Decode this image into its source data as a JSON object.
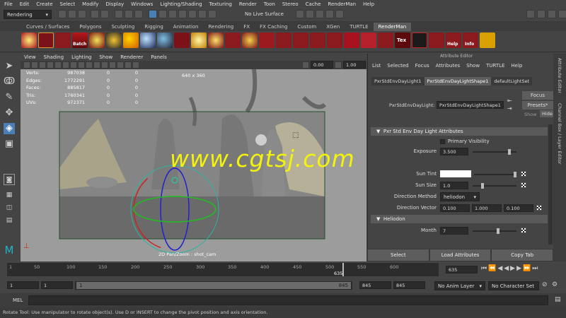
{
  "menubar": [
    "File",
    "Edit",
    "Create",
    "Select",
    "Modify",
    "Display",
    "Windows",
    "Lighting/Shading",
    "Texturing",
    "Render",
    "Toon",
    "Stereo",
    "Cache",
    "RenderMan",
    "Help"
  ],
  "statusline": {
    "menu_set": "Rendering",
    "live_surface": "No Live Surface"
  },
  "shelf_tabs": [
    "Curves / Surfaces",
    "Polygons",
    "Sculpting",
    "Rigging",
    "Animation",
    "Rendering",
    "FX",
    "FX Caching",
    "Custom",
    "XGen",
    "TURTLE",
    "RenderMan"
  ],
  "shelf_active": "RenderMan",
  "shelf_labels": {
    "batch": "Batch",
    "tex": "Tex",
    "help": "Help",
    "info": "Info"
  },
  "viewport": {
    "menu": [
      "View",
      "Shading",
      "Lighting",
      "Show",
      "Renderer",
      "Panels"
    ],
    "exposure": "0.00",
    "gamma": "1.00",
    "resolution": "640 x 360",
    "camera": "2D Pan/Zoom : shot_cam",
    "hud": [
      {
        "label": "Verts:",
        "a": "987038",
        "b": "0",
        "c": "0"
      },
      {
        "label": "Edges:",
        "a": "1772291",
        "b": "0",
        "c": "0"
      },
      {
        "label": "Faces:",
        "a": "885817",
        "b": "0",
        "c": "0"
      },
      {
        "label": "Tris:",
        "a": "1760341",
        "b": "0",
        "c": "0"
      },
      {
        "label": "UVs:",
        "a": "972371",
        "b": "0",
        "c": "0"
      }
    ]
  },
  "watermark": "www.cgtsj.com",
  "attr_editor": {
    "title": "Attribute Editor",
    "menu": [
      "List",
      "Selected",
      "Focus",
      "Attributes",
      "Show",
      "TURTLE",
      "Help"
    ],
    "tabs": [
      "PxrStdEnvDayLight1",
      "PxrStdEnvDayLightShape1",
      "defaultLightSet"
    ],
    "node_label": "PxrStdEnvDayLight:",
    "node_value": "PxrStdEnvDayLightShape1",
    "focus": "Focus",
    "presets": "Presets*",
    "show": "Show",
    "hide": "Hide",
    "section1": "Pxr  Std  Env  Day  Light  Attributes",
    "primary_visibility": "Primary Visibility",
    "exposure_label": "Exposure",
    "exposure_value": "3.500",
    "exposure_level": 0.85,
    "sun_tint_label": "Sun Tint",
    "sun_size_label": "Sun Size",
    "sun_size_value": "1.0",
    "sun_size_level": 0.2,
    "direction_method_label": "Direction Method",
    "direction_method_value": "heliodon",
    "direction_vector_label": "Direction Vector",
    "dir_x": "0.100",
    "dir_y": "1.000",
    "dir_z": "0.100",
    "section2": "Heliodon",
    "month_label": "Month",
    "month_value": "7",
    "month_level": 0.55,
    "buttons": [
      "Select",
      "Load Attributes",
      "Copy Tab"
    ]
  },
  "side_tabs": [
    "Attribute Editor",
    "Channel Box / Layer Editor"
  ],
  "timeslider": {
    "ticks": [
      "1",
      "50",
      "100",
      "150",
      "200",
      "250",
      "300",
      "350",
      "400",
      "450",
      "500",
      "550",
      "600"
    ],
    "current": "635",
    "current_field": "635"
  },
  "range": {
    "start": "1",
    "start2": "1",
    "range_start": "1",
    "range_end": "845",
    "end": "845",
    "end2": "845",
    "anim_layer": "No Anim Layer",
    "char_set": "No Character Set"
  },
  "mel": "MEL",
  "help_line": "Rotate Tool: Use manipulator to rotate object(s). Use D or INSERT to change the pivot position and axis orientation."
}
